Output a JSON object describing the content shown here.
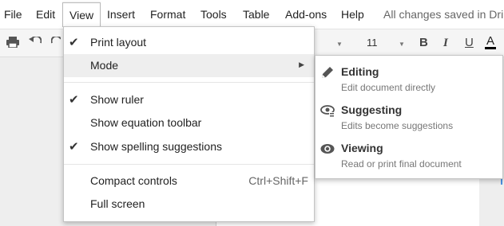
{
  "menubar": {
    "items": [
      "File",
      "Edit",
      "View",
      "Insert",
      "Format",
      "Tools",
      "Table",
      "Add-ons",
      "Help"
    ],
    "status": "All changes saved in Dri"
  },
  "toolbar": {
    "font_size": "11",
    "bold": "B",
    "italic": "I",
    "underline": "U",
    "text_color": "A",
    "text_color_hex": "#000000"
  },
  "view_menu": {
    "print_layout": {
      "label": "Print layout",
      "checked": true
    },
    "mode": {
      "label": "Mode"
    },
    "show_ruler": {
      "label": "Show ruler",
      "checked": true
    },
    "show_equation_toolbar": {
      "label": "Show equation toolbar",
      "checked": false
    },
    "show_spelling": {
      "label": "Show spelling suggestions",
      "checked": true
    },
    "compact_controls": {
      "label": "Compact controls",
      "shortcut": "Ctrl+Shift+F"
    },
    "full_screen": {
      "label": "Full screen"
    }
  },
  "mode_menu": {
    "editing": {
      "title": "Editing",
      "desc": "Edit document directly",
      "icon": "pencil-icon"
    },
    "suggesting": {
      "title": "Suggesting",
      "desc": "Edits become suggestions",
      "icon": "suggest-icon"
    },
    "viewing": {
      "title": "Viewing",
      "desc": "Read or print final document",
      "icon": "eye-icon"
    }
  }
}
